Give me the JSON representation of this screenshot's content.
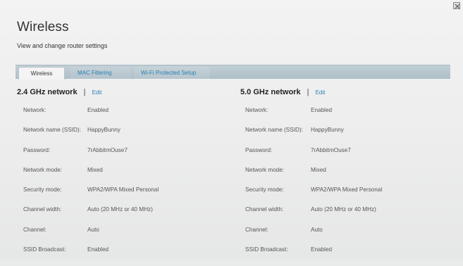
{
  "header": {
    "title": "Wireless",
    "subtitle": "View and change router settings"
  },
  "tabs": [
    {
      "label": "Wireless",
      "active": true
    },
    {
      "label": "MAC Filtering",
      "active": false
    },
    {
      "label": "Wi-Fi Protected Setup",
      "active": false
    }
  ],
  "networks": [
    {
      "heading": "2.4 GHz network",
      "separator": "|",
      "edit_label": "Edit",
      "rows": [
        {
          "label": "Network:",
          "value": "Enabled"
        },
        {
          "label": "Network name (SSID):",
          "value": "HappyBunny"
        },
        {
          "label": "Password:",
          "value": "7rAbbitmOuse7"
        },
        {
          "label": "Network mode:",
          "value": "Mixed"
        },
        {
          "label": "Security mode:",
          "value": "WPA2/WPA Mixed Personal"
        },
        {
          "label": "Channel width:",
          "value": "Auto (20 MHz or 40 MHz)"
        },
        {
          "label": "Channel:",
          "value": "Auto"
        },
        {
          "label": "SSID Broadcast:",
          "value": "Enabled"
        }
      ]
    },
    {
      "heading": "5.0 GHz network",
      "separator": "|",
      "edit_label": "Edit",
      "rows": [
        {
          "label": "Network:",
          "value": "Enabled"
        },
        {
          "label": "Network name (SSID):",
          "value": "HappyBunny"
        },
        {
          "label": "Password:",
          "value": "7rAbbitmOuse7"
        },
        {
          "label": "Network mode:",
          "value": "Mixed"
        },
        {
          "label": "Security mode:",
          "value": "WPA2/WPA Mixed Personal"
        },
        {
          "label": "Channel width:",
          "value": "Auto (20 MHz or 40 MHz)"
        },
        {
          "label": "Channel:",
          "value": "Auto"
        },
        {
          "label": "SSID Broadcast:",
          "value": "Enabled"
        }
      ]
    }
  ],
  "icons": {
    "close": "close-icon"
  }
}
